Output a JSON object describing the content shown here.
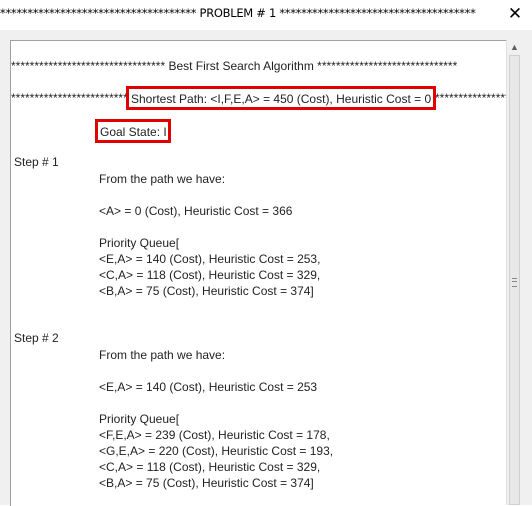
{
  "window": {
    "title": "************************************ PROBLEM # 1 ************************************"
  },
  "heading": "********************************* Best First Search Algorithm ******************************",
  "shortest_path_row": {
    "stars_left": "*************************",
    "label": "Shortest Path: <I,F,E,A> = 450 (Cost), Heuristic Cost = 0",
    "stars_right": "****************"
  },
  "goal_state": "Goal State: I",
  "steps": [
    {
      "label": "Step # 1",
      "intro": "From the path we have:",
      "current": "<A> = 0 (Cost), Heuristic Cost = 366",
      "queue_title": "Priority Queue[",
      "queue": [
        "<E,A> = 140 (Cost), Heuristic Cost = 253,",
        "<C,A> = 118 (Cost), Heuristic Cost = 329,",
        "<B,A> = 75 (Cost), Heuristic Cost = 374]"
      ]
    },
    {
      "label": "Step # 2",
      "intro": "From the path we have:",
      "current": "<E,A> = 140 (Cost), Heuristic Cost = 253",
      "queue_title": "Priority Queue[",
      "queue": [
        "<F,E,A> = 239 (Cost), Heuristic Cost = 178,",
        "<G,E,A> = 220 (Cost), Heuristic Cost = 193,",
        "<C,A> = 118 (Cost), Heuristic Cost = 329,",
        "<B,A> = 75 (Cost), Heuristic Cost = 374]"
      ]
    }
  ]
}
